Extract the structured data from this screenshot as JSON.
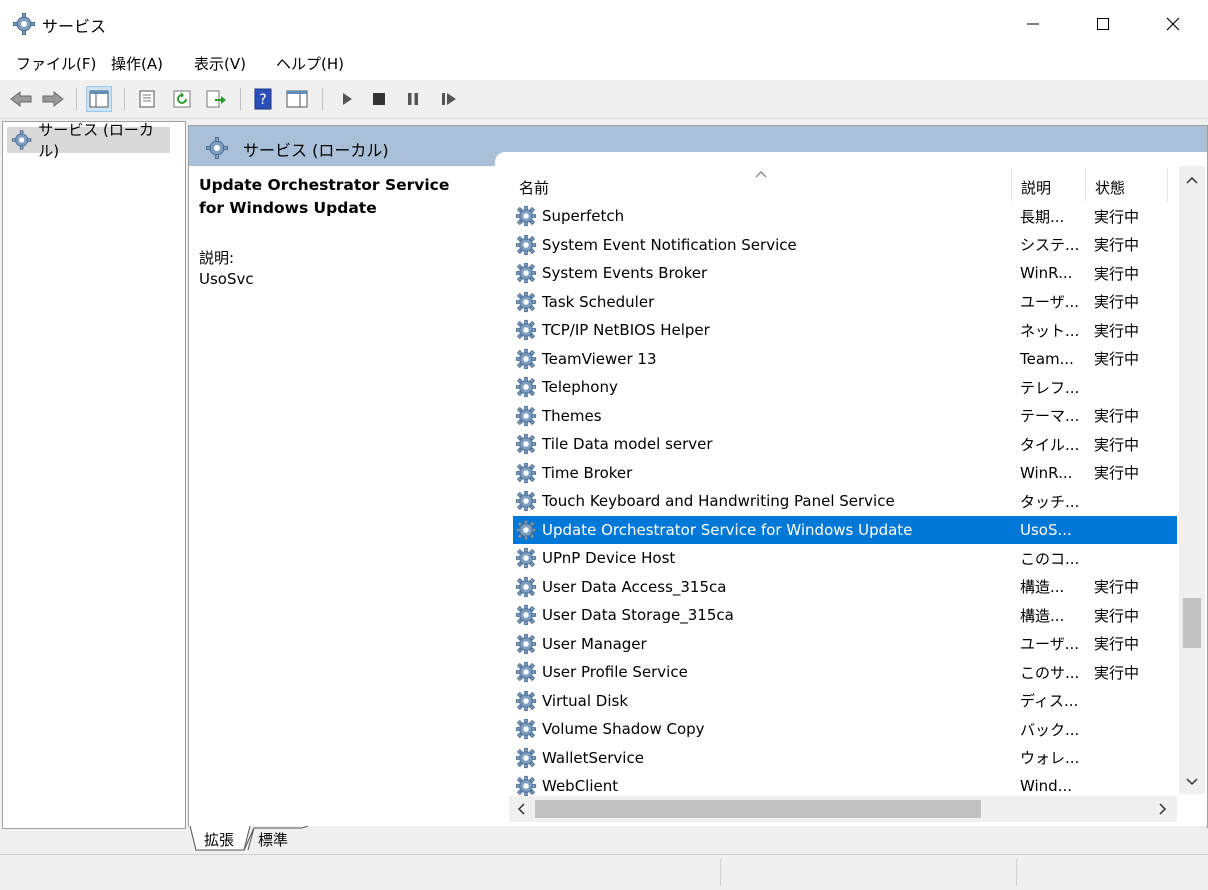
{
  "window": {
    "title": "サービス",
    "controls": [
      "minimize-icon",
      "maximize-icon",
      "close-icon"
    ]
  },
  "menu": {
    "items": [
      "ファイル(F)",
      "操作(A)",
      "表示(V)",
      "ヘルプ(H)"
    ]
  },
  "tree": {
    "root_label": "サービス (ローカル)"
  },
  "pane": {
    "header_title": "サービス (ローカル)",
    "detail_title": "Update Orchestrator Service for Windows Update",
    "desc_label": "説明:",
    "desc_value": "UsoSvc"
  },
  "columns": {
    "name": "名前",
    "description": "説明",
    "status": "状態"
  },
  "rows": [
    {
      "name": "Superfetch",
      "description": "長期...",
      "status": "実行中"
    },
    {
      "name": "System Event Notification Service",
      "description": "システ...",
      "status": "実行中"
    },
    {
      "name": "System Events Broker",
      "description": "WinR...",
      "status": "実行中"
    },
    {
      "name": "Task Scheduler",
      "description": "ユーザ...",
      "status": "実行中"
    },
    {
      "name": "TCP/IP NetBIOS Helper",
      "description": "ネット...",
      "status": "実行中"
    },
    {
      "name": "TeamViewer 13",
      "description": "Team...",
      "status": "実行中"
    },
    {
      "name": "Telephony",
      "description": "テレフ...",
      "status": ""
    },
    {
      "name": "Themes",
      "description": "テーマ...",
      "status": "実行中"
    },
    {
      "name": "Tile Data model server",
      "description": "タイル...",
      "status": "実行中"
    },
    {
      "name": "Time Broker",
      "description": "WinR...",
      "status": "実行中"
    },
    {
      "name": "Touch Keyboard and Handwriting Panel Service",
      "description": "タッチ...",
      "status": ""
    },
    {
      "name": "Update Orchestrator Service for Windows Update",
      "description": "UsoS...",
      "status": "",
      "selected": true
    },
    {
      "name": "UPnP Device Host",
      "description": "このコ...",
      "status": ""
    },
    {
      "name": "User Data Access_315ca",
      "description": "構造...",
      "status": "実行中"
    },
    {
      "name": "User Data Storage_315ca",
      "description": "構造...",
      "status": "実行中"
    },
    {
      "name": "User Manager",
      "description": "ユーザ...",
      "status": "実行中"
    },
    {
      "name": "User Profile Service",
      "description": "このサ...",
      "status": "実行中"
    },
    {
      "name": "Virtual Disk",
      "description": "ディス...",
      "status": ""
    },
    {
      "name": "Volume Shadow Copy",
      "description": "バック...",
      "status": ""
    },
    {
      "name": "WalletService",
      "description": "ウォレ...",
      "status": ""
    },
    {
      "name": "WebClient",
      "description": "Wind...",
      "status": ""
    }
  ],
  "tabs": {
    "extended": "拡張",
    "standard": "標準"
  },
  "colors": {
    "selection": "#0078d7",
    "header_band": "#a9c0d8",
    "gear": "#5b8fb9"
  }
}
